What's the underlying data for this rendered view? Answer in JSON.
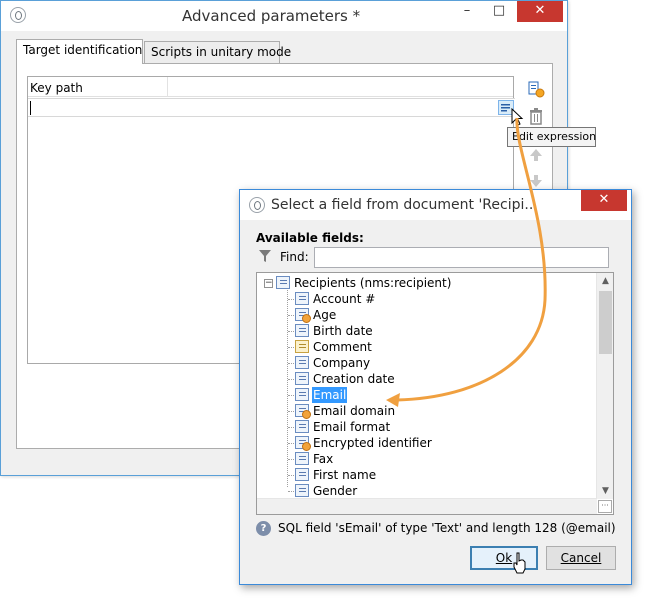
{
  "main_window": {
    "title": "Advanced parameters *",
    "tabs": [
      {
        "label": "Target identification",
        "active": true
      },
      {
        "label": "Scripts in unitary mode",
        "active": false
      }
    ],
    "column_header": "Key path",
    "key_path_value": "",
    "tooltip": "Edit expression",
    "controls": {
      "minimize": "–",
      "maximize": "□",
      "close": "✕"
    }
  },
  "dialog": {
    "title": "Select a field from document 'Recipi...",
    "available_fields_label": "Available fields:",
    "find_label": "Find:",
    "find_value": "",
    "tree": {
      "root": "Recipients (nms:recipient)",
      "root_expander": "−",
      "items": [
        {
          "label": "Account #",
          "icon": "field-icon"
        },
        {
          "label": "Age",
          "icon": "linked-field-icon"
        },
        {
          "label": "Birth date",
          "icon": "field-icon"
        },
        {
          "label": "Comment",
          "icon": "memo-field-icon"
        },
        {
          "label": "Company",
          "icon": "field-icon"
        },
        {
          "label": "Creation date",
          "icon": "field-icon"
        },
        {
          "label": "Email",
          "icon": "field-icon",
          "selected": true
        },
        {
          "label": "Email domain",
          "icon": "linked-field-icon"
        },
        {
          "label": "Email format",
          "icon": "field-icon"
        },
        {
          "label": "Encrypted identifier",
          "icon": "linked-field-icon"
        },
        {
          "label": "Fax",
          "icon": "field-icon"
        },
        {
          "label": "First name",
          "icon": "field-icon"
        },
        {
          "label": "Gender",
          "icon": "field-icon"
        }
      ]
    },
    "status": "SQL field 'sEmail' of type 'Text' and length 128 (@email)",
    "ok_label": "Ok",
    "cancel_label": "Cancel",
    "controls": {
      "close": "✕"
    }
  },
  "colors": {
    "selection": "#3399ff",
    "callout_arrow": "#f0a040",
    "close_button": "#c7372f"
  }
}
